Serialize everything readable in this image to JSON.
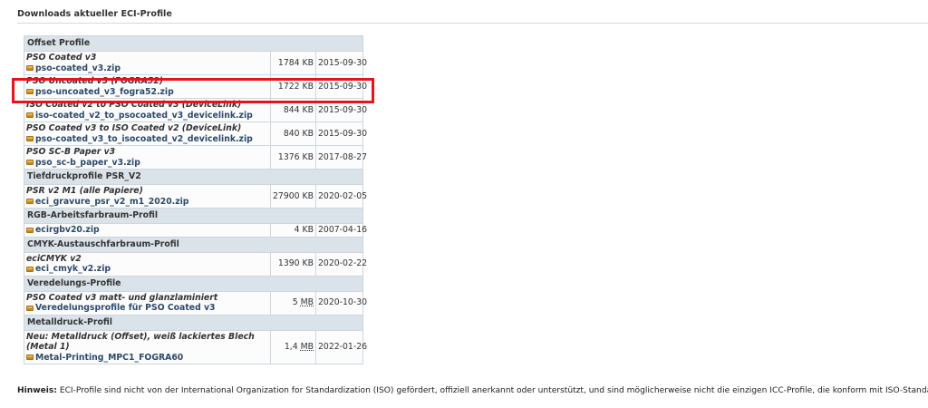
{
  "heading": "Downloads aktueller ECI-Profile",
  "groups": [
    {
      "label": "Offset Profile",
      "items": [
        {
          "title": "PSO Coated v3",
          "file": "pso-coated_v3.zip",
          "size": "1784 KB",
          "date": "2015-09-30"
        },
        {
          "title": "PSO Uncoated v3 (FOGRA52)",
          "file": "pso-uncoated_v3_fogra52.zip",
          "size": "1722 KB",
          "date": "2015-09-30"
        },
        {
          "title": "ISO Coated v2 to PSO Coated v3 (DeviceLink)",
          "file": "iso-coated_v2_to_psocoated_v3_devicelink.zip",
          "size": "844 KB",
          "date": "2015-09-30"
        },
        {
          "title": "PSO Coated v3 to ISO Coated v2 (DeviceLink)",
          "file": "pso-coated_v3_to_isocoated_v2_devicelink.zip",
          "size": "840 KB",
          "date": "2015-09-30"
        },
        {
          "title": "PSO SC-B Paper v3",
          "file": "pso_sc-b_paper_v3.zip",
          "size": "1376 KB",
          "date": "2017-08-27"
        }
      ]
    },
    {
      "label": "Tiefdruckprofile PSR_V2",
      "items": [
        {
          "title": "PSR v2 M1 (alle Papiere)",
          "file": "eci_gravure_psr_v2_m1_2020.zip",
          "size": "27900 KB",
          "date": "2020-02-05"
        }
      ]
    },
    {
      "label": "RGB-Arbeitsfarbraum-Profil",
      "items": [
        {
          "title": "",
          "file": "ecirgbv20.zip",
          "size": "4 KB",
          "date": "2007-04-16"
        }
      ]
    },
    {
      "label": "CMYK-Austauschfarbraum-Profil",
      "items": [
        {
          "title": "eciCMYK v2",
          "file": "eci_cmyk_v2.zip",
          "size": "1390 KB",
          "date": "2020-02-22"
        }
      ]
    },
    {
      "label": "Veredelungs-Profile",
      "items": [
        {
          "title": "PSO Coated v3 matt- und glanzlaminiert",
          "file": "Veredelungsprofile für PSO Coated v3",
          "size_value": "5",
          "size_unit": "MB",
          "date": "2020-10-30"
        }
      ]
    },
    {
      "label": "Metalldruck-Profil",
      "items": [
        {
          "title": "Neu: Metalldruck (Offset), weiß lackiertes Blech (Metal 1)",
          "file": "Metal-Printing_MPC1_FOGRA60",
          "size_value": "1,4",
          "size_unit": "MB",
          "date": "2022-01-26"
        }
      ]
    }
  ],
  "note": {
    "label": "Hinweis:",
    "text": " ECI-Profile sind nicht von der International Organization for Standardization (ISO) gefördert, offiziell anerkannt oder unterstützt, und sind möglicherweise nicht die einzigen ICC-Profile, die konform mit ISO-Standards sind."
  },
  "icons": {
    "file": "zip-archive-icon"
  },
  "colors": {
    "group_header_bg": "#dbe3ea",
    "link": "#2c4a6a",
    "highlight": "#e8141c"
  }
}
